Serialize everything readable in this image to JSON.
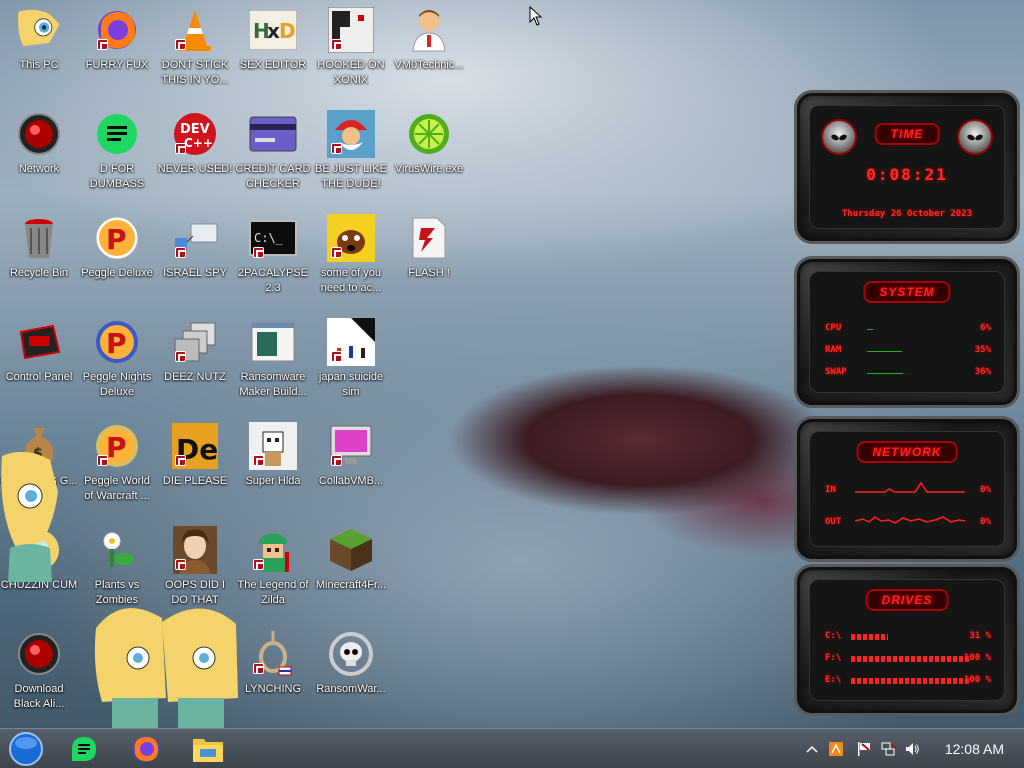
{
  "desktop_icons": [
    {
      "label": "This PC",
      "icon": "star-cartoon-icon"
    },
    {
      "label": "FURRY FUX",
      "icon": "firefox-icon"
    },
    {
      "label": "DONT STICK THIS IN YO...",
      "icon": "vlc-cone-icon"
    },
    {
      "label": "SEX EDITOR",
      "icon": "hxd-editor-icon"
    },
    {
      "label": "HOOKED ON XONIX",
      "icon": "xonix-game-icon"
    },
    {
      "label": "VM0Technic...",
      "icon": "doctor-avatar-icon"
    },
    {
      "label": "Network",
      "icon": "red-orb-icon"
    },
    {
      "label": "D FOR DUMBASS",
      "icon": "discord-chat-icon"
    },
    {
      "label": "NEVER USED!",
      "icon": "dev-cpp-icon"
    },
    {
      "label": "CREDIT CARD CHECKER",
      "icon": "credit-card-icon"
    },
    {
      "label": "BE JUST LIKE THE DUDE!",
      "icon": "santa-avatar-icon"
    },
    {
      "label": "VirusWire.exe",
      "icon": "limewire-icon"
    },
    {
      "label": "Recycle Bin",
      "icon": "red-bin-icon"
    },
    {
      "label": "Peggle Deluxe",
      "icon": "peggle-icon"
    },
    {
      "label": "ISRAEL SPY",
      "icon": "spy-network-icon"
    },
    {
      "label": "2PACALYPSE 2.3",
      "icon": "terminal-icon"
    },
    {
      "label": "some of you need to ac...",
      "icon": "dog-cartoon-icon"
    },
    {
      "label": "FLASH !",
      "icon": "flash-player-icon"
    },
    {
      "label": "Control Panel",
      "icon": "red-hardware-icon"
    },
    {
      "label": "Peggle Nights Deluxe",
      "icon": "peggle-nights-icon"
    },
    {
      "label": "DEEZ NUTZ",
      "icon": "stacked-windows-icon"
    },
    {
      "label": "Ransomware Maker Build...",
      "icon": "app-window-icon"
    },
    {
      "label": "japan suicide sim",
      "icon": "pixel-game-icon"
    },
    {
      "label": "CONSTS S G...",
      "icon": "money-bag-icon"
    },
    {
      "label": "Peggle World of Warcraft ...",
      "icon": "peggle-wow-icon"
    },
    {
      "label": "DIE PLEASE",
      "icon": "de-letters-icon"
    },
    {
      "label": "Super Hlda",
      "icon": "pixel-cat-icon"
    },
    {
      "label": "CollabVMB...",
      "icon": "monitor-icon"
    },
    {
      "label": "CHUZZIN CUM",
      "icon": "star-cartoon-icon"
    },
    {
      "label": "Plants vs Zombies",
      "icon": "plants-zombies-icon"
    },
    {
      "label": "OOPS DID I DO THAT",
      "icon": "portrait-icon"
    },
    {
      "label": "The Legend of Zilda",
      "icon": "pixel-hero-icon"
    },
    {
      "label": "Minecraft4Fr...",
      "icon": "grass-block-icon"
    },
    {
      "label": "Download Black Ali...",
      "icon": "red-orb-icon"
    },
    {
      "label": "LYNCHING",
      "icon": "noose-icon"
    },
    {
      "label": "RansomWar...",
      "icon": "skull-icon"
    }
  ],
  "taskbar": {
    "items": [
      "start-orb-icon",
      "chat-app-icon",
      "firefox-icon",
      "file-explorer-icon"
    ],
    "clock": "12:08 AM",
    "tray": [
      "chevron-up-icon",
      "tray-app-icon",
      "flag-icon",
      "network-icon",
      "volume-icon"
    ]
  },
  "widget": {
    "time": {
      "title": "TIME",
      "clock": "0:08:21",
      "date": "Thursday 26 October 2023"
    },
    "system": {
      "title": "SYSTEM",
      "rows": [
        {
          "label": "CPU",
          "value": "6%",
          "level": 0.06
        },
        {
          "label": "RAM",
          "value": "35%",
          "level": 0.35
        },
        {
          "label": "SWAP",
          "value": "36%",
          "level": 0.36
        }
      ]
    },
    "network": {
      "title": "NETWORK",
      "rows": [
        {
          "label": "IN",
          "value": "0%"
        },
        {
          "label": "OUT",
          "value": "0%"
        }
      ]
    },
    "drives": {
      "title": "DRIVES",
      "rows": [
        {
          "label": "C:\\",
          "value": "31 %",
          "level": 0.31
        },
        {
          "label": "F:\\",
          "value": "100 %",
          "level": 1.0
        },
        {
          "label": "E:\\",
          "value": "100 %",
          "level": 1.0
        }
      ]
    }
  },
  "colors": {
    "accent_red": "#ff2020",
    "bar_green": "#1db31d"
  }
}
